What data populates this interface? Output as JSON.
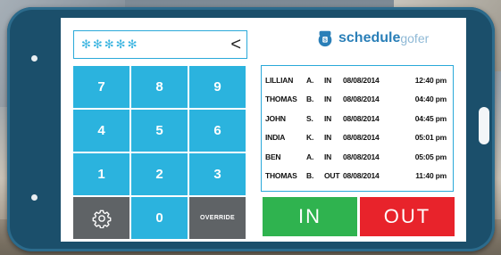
{
  "pin": {
    "value": "✻✻✻✻✻"
  },
  "keypad": {
    "keys": [
      "7",
      "8",
      "9",
      "4",
      "5",
      "6",
      "1",
      "2",
      "3"
    ],
    "zero": "0",
    "override": "OVERRIDE",
    "settings_icon": "gear-icon",
    "backspace_icon": "chevron-left-icon",
    "backspace_glyph": "<"
  },
  "logo": {
    "part1": "schedule",
    "part2": "gofer"
  },
  "punches": [
    {
      "first": "LILLIAN",
      "initial": "A.",
      "status": "IN",
      "date": "08/08/2014",
      "time": "12:40 pm"
    },
    {
      "first": "THOMAS",
      "initial": "B.",
      "status": "IN",
      "date": "08/08/2014",
      "time": "04:40 pm"
    },
    {
      "first": "JOHN",
      "initial": "S.",
      "status": "IN",
      "date": "08/08/2014",
      "time": "04:45 pm"
    },
    {
      "first": "INDIA",
      "initial": "K.",
      "status": "IN",
      "date": "08/08/2014",
      "time": "05:01 pm"
    },
    {
      "first": "BEN",
      "initial": "A.",
      "status": "IN",
      "date": "08/08/2014",
      "time": "05:05 pm"
    },
    {
      "first": "THOMAS",
      "initial": "B.",
      "status": "OUT",
      "date": "08/08/2014",
      "time": "11:40 pm"
    }
  ],
  "actions": {
    "in_label": "IN",
    "out_label": "OUT"
  },
  "colors": {
    "keypad_blue": "#2bb3de",
    "keypad_dark": "#5f6366",
    "in_green": "#2fb34f",
    "out_red": "#e8232b",
    "tablet_frame": "#1b4f6b",
    "brand_blue": "#2a7fb8"
  }
}
